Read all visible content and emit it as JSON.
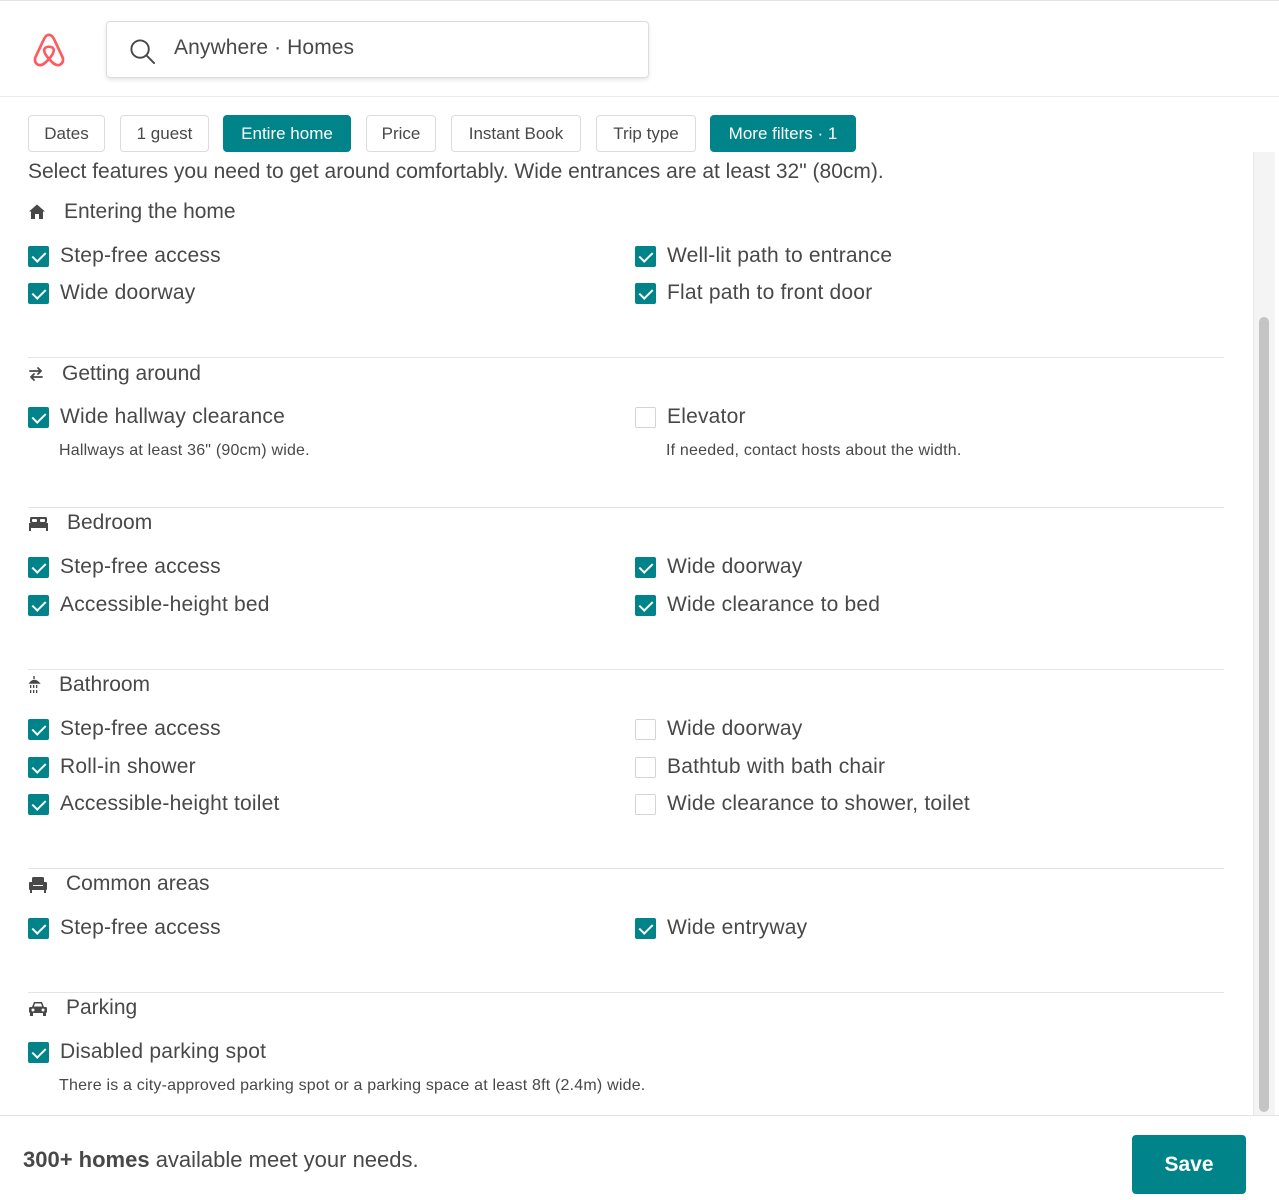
{
  "search": {
    "text": "Anywhere · Homes"
  },
  "filters": [
    {
      "label": "Dates",
      "active": false
    },
    {
      "label": "1 guest",
      "active": false
    },
    {
      "label": "Entire home",
      "active": true
    },
    {
      "label": "Price",
      "active": false
    },
    {
      "label": "Instant Book",
      "active": false
    },
    {
      "label": "Trip type",
      "active": false
    },
    {
      "label": "More filters · 1",
      "active": true
    }
  ],
  "intro": "Select features you need to get around comfortably. Wide entrances are at least 32\" (80cm).",
  "sections": [
    {
      "title": "Entering the home",
      "icon": "home-icon",
      "left": [
        {
          "label": "Step-free access",
          "checked": true
        },
        {
          "label": "Wide doorway",
          "checked": true
        }
      ],
      "right": [
        {
          "label": "Well-lit path to entrance",
          "checked": true
        },
        {
          "label": "Flat path to front door",
          "checked": true
        }
      ]
    },
    {
      "title": "Getting around",
      "icon": "arrows-swap-icon",
      "left": [
        {
          "label": "Wide hallway clearance",
          "checked": true,
          "note": "Hallways at least 36\" (90cm) wide."
        }
      ],
      "right": [
        {
          "label": "Elevator",
          "checked": false,
          "note": "If needed, contact hosts about the width."
        }
      ]
    },
    {
      "title": "Bedroom",
      "icon": "bed-icon",
      "left": [
        {
          "label": "Step-free access",
          "checked": true
        },
        {
          "label": "Accessible-height bed",
          "checked": true
        }
      ],
      "right": [
        {
          "label": "Wide doorway",
          "checked": true
        },
        {
          "label": "Wide clearance to bed",
          "checked": true
        }
      ]
    },
    {
      "title": "Bathroom",
      "icon": "shower-icon",
      "left": [
        {
          "label": "Step-free access",
          "checked": true
        },
        {
          "label": "Roll-in shower",
          "checked": true
        },
        {
          "label": "Accessible-height toilet",
          "checked": true
        }
      ],
      "right": [
        {
          "label": "Wide doorway",
          "checked": false
        },
        {
          "label": "Bathtub with bath chair",
          "checked": false
        },
        {
          "label": "Wide clearance to shower, toilet",
          "checked": false
        }
      ]
    },
    {
      "title": "Common areas",
      "icon": "armchair-icon",
      "left": [
        {
          "label": "Step-free access",
          "checked": true
        }
      ],
      "right": [
        {
          "label": "Wide entryway",
          "checked": true
        }
      ]
    },
    {
      "title": "Parking",
      "icon": "car-icon",
      "left": [
        {
          "label": "Disabled parking spot",
          "checked": true,
          "note": "There is a city-approved parking spot or a parking space at least 8ft (2.4m) wide."
        }
      ],
      "right": []
    }
  ],
  "footer": {
    "count": "300+ homes",
    "rest": " available meet your needs.",
    "save_label": "Save"
  },
  "colors": {
    "accent": "#008489",
    "brand": "#FF5A5F",
    "text": "#484848"
  }
}
